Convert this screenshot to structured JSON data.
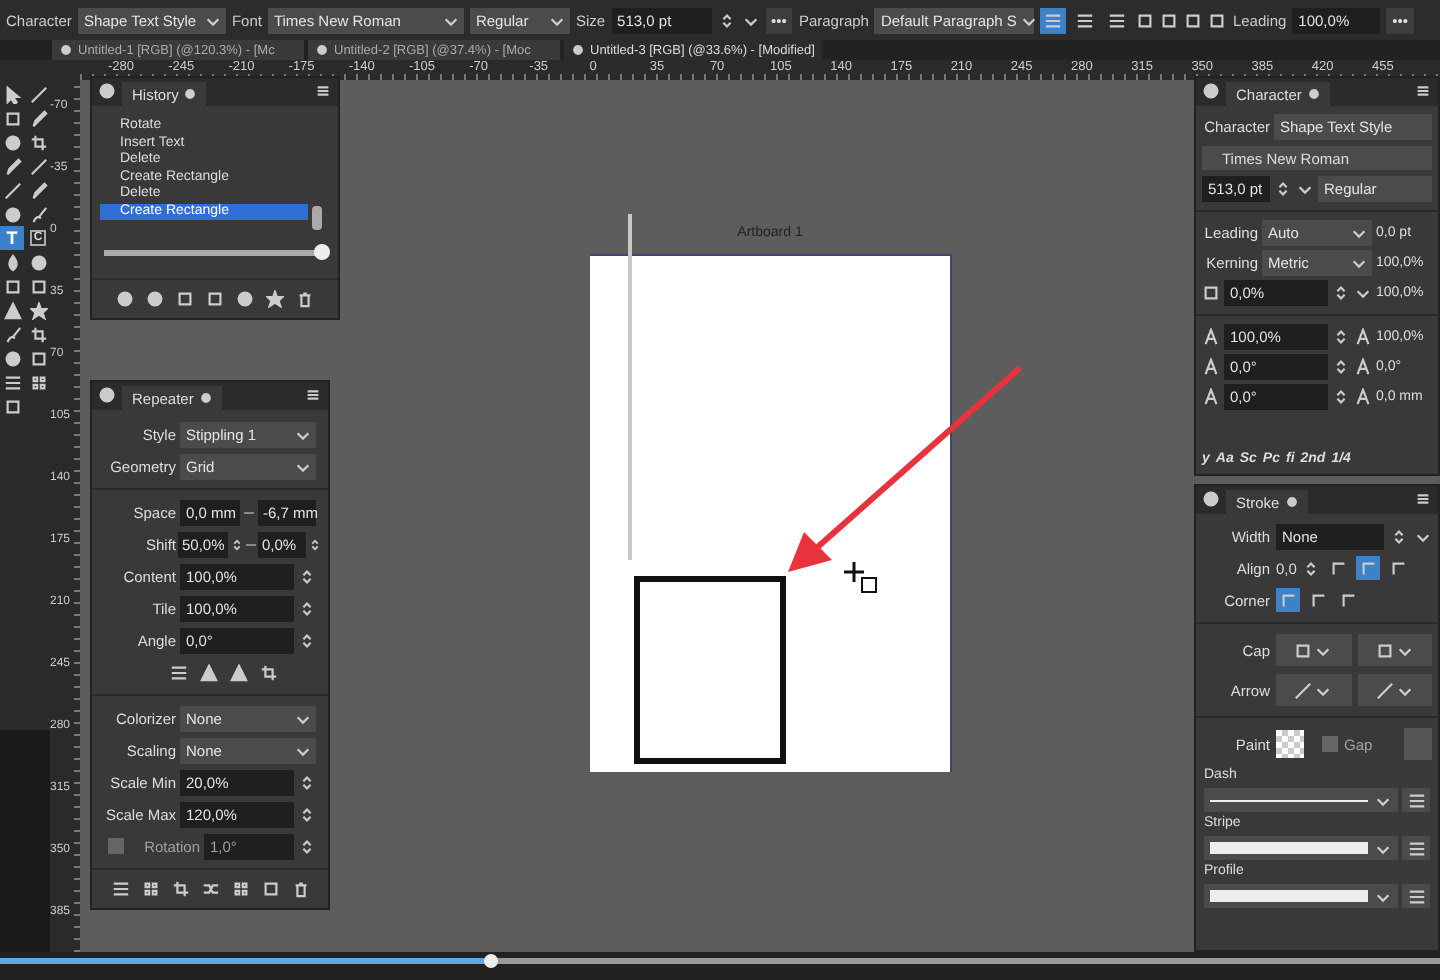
{
  "context_bar": {
    "character_label": "Character",
    "character_style": "Shape Text Style",
    "font_label": "Font",
    "font": "Times New Roman",
    "font_style": "Regular",
    "size_label": "Size",
    "size": "513,0 pt",
    "more": "•••",
    "paragraph_label": "Paragraph",
    "paragraph_style": "Default Paragraph S",
    "align_buttons": [
      {
        "selected": true
      },
      {
        "selected": false
      },
      {
        "selected": false
      }
    ],
    "leading_label": "Leading",
    "leading": "100,0%",
    "more_2": "•••"
  },
  "document_tabs": [
    {
      "label": "Untitled-1 [RGB] (@120.3%) - [Mc",
      "selected": false
    },
    {
      "label": "Untitled-2 [RGB] (@37.4%) - [Moc",
      "selected": false
    },
    {
      "label": "Untitled-3 [RGB] (@33.6%) - [Modified]",
      "selected": true
    }
  ],
  "ruler_h": [
    "-280",
    "-245",
    "-210",
    "-175",
    "-140",
    "-105",
    "-70",
    "-35",
    "0",
    "35",
    "70",
    "105",
    "140",
    "175",
    "210",
    "245",
    "280",
    "315",
    "350",
    "385",
    "420",
    "455"
  ],
  "ruler_v": [
    "-70",
    "-35",
    "0",
    "35",
    "70",
    "105",
    "140",
    "175",
    "210",
    "245",
    "280",
    "315",
    "350",
    "385"
  ],
  "tools": [
    {
      "selected": false
    },
    {
      "selected": false
    },
    {
      "selected": false
    },
    {
      "selected": false
    },
    {
      "selected": false
    },
    {
      "selected": false
    },
    {
      "selected": false
    },
    {
      "selected": false
    },
    {
      "selected": false
    },
    {
      "selected": false
    },
    {
      "selected": false
    },
    {
      "selected": false
    },
    {
      "selected": true,
      "label": "T"
    },
    {
      "selected": false,
      "label": "C"
    },
    {
      "selected": false
    },
    {
      "selected": false
    },
    {
      "selected": false
    },
    {
      "selected": false
    },
    {
      "selected": false
    },
    {
      "selected": false
    },
    {
      "selected": false
    },
    {
      "selected": false
    },
    {
      "selected": false
    },
    {
      "selected": false
    },
    {
      "selected": false
    },
    {
      "selected": false
    },
    {
      "selected": false
    }
  ],
  "history": {
    "tab": "History",
    "items": [
      {
        "label": "Rotate",
        "selected": false
      },
      {
        "label": "Insert Text",
        "selected": false
      },
      {
        "label": "Delete",
        "selected": false
      },
      {
        "label": "Create Rectangle",
        "selected": false
      },
      {
        "label": "Delete",
        "selected": false
      },
      {
        "label": "Create Rectangle",
        "selected": true
      }
    ],
    "slider": {
      "level": 1
    }
  },
  "repeater": {
    "tab": "Repeater",
    "rows": [
      {
        "kind": "dropdown",
        "label": "Style",
        "value": "Stippling 1"
      },
      {
        "kind": "dropdown",
        "label": "Geometry",
        "value": "Grid"
      },
      {
        "kind": "divider"
      },
      {
        "kind": "pair",
        "label": "Space",
        "value": "0,0 mm",
        "value_2": "-6,7 mm"
      },
      {
        "kind": "spin_pair",
        "label": "Shift",
        "value": "50,0%",
        "value_2": "0,0%"
      },
      {
        "kind": "spinner",
        "label": "Content",
        "value": "100,0%"
      },
      {
        "kind": "spinner",
        "label": "Tile",
        "value": "100,0%"
      },
      {
        "kind": "spinner",
        "label": "Angle",
        "value": "0,0°"
      },
      {
        "kind": "icons"
      },
      {
        "kind": "divider"
      },
      {
        "kind": "dropdown",
        "label": "Colorizer",
        "value": "None"
      },
      {
        "kind": "dropdown",
        "label": "Scaling",
        "value": "None"
      },
      {
        "kind": "spinner",
        "label": "Scale Min",
        "value": "20,0%"
      },
      {
        "kind": "spinner",
        "label": "Scale Max",
        "value": "120,0%"
      },
      {
        "kind": "checkbox",
        "label": "Rotation",
        "value": "1,0°",
        "checked": false
      }
    ]
  },
  "character": {
    "tab": "Character",
    "style_label": "Character",
    "style": "Shape Text Style",
    "font": "Times New Roman",
    "size": "513,0 pt",
    "weight": "Regular",
    "rows": [
      {
        "label": "Leading",
        "value": "Auto",
        "value_2": "0,0 pt"
      },
      {
        "label": "Kerning",
        "value": "Metric",
        "value_2": "100,0%"
      }
    ],
    "grid": [
      {
        "value": "0,0%",
        "value_2": "100,0%"
      },
      {
        "value": "100,0%",
        "value_2": "100,0%"
      },
      {
        "value": "0,0°",
        "value_2": "0,0°"
      },
      {
        "value": "0,0°",
        "value_2": "0,0 mm"
      }
    ],
    "typography": [
      "y",
      "Aa",
      "Sc",
      "Pc",
      "fi",
      "2nd",
      "1/4"
    ]
  },
  "stroke": {
    "tab": "Stroke",
    "width_label": "Width",
    "width": "None",
    "align_label": "Align",
    "align": "0,0",
    "align_buttons": [
      {
        "selected": false
      },
      {
        "selected": true
      },
      {
        "selected": false
      }
    ],
    "corner_label": "Corner",
    "corner_buttons": [
      {
        "selected": true
      },
      {
        "selected": false
      },
      {
        "selected": false
      }
    ],
    "cap_label": "Cap",
    "arrow_label": "Arrow",
    "paint_label": "Paint",
    "gap": {
      "label": "Gap",
      "checked": false,
      "disabled": true
    },
    "sections": [
      "Dash",
      "Stripe",
      "Profile"
    ]
  },
  "artboard": {
    "label": "Artboard 1"
  },
  "playback": {
    "level": 0.34
  }
}
